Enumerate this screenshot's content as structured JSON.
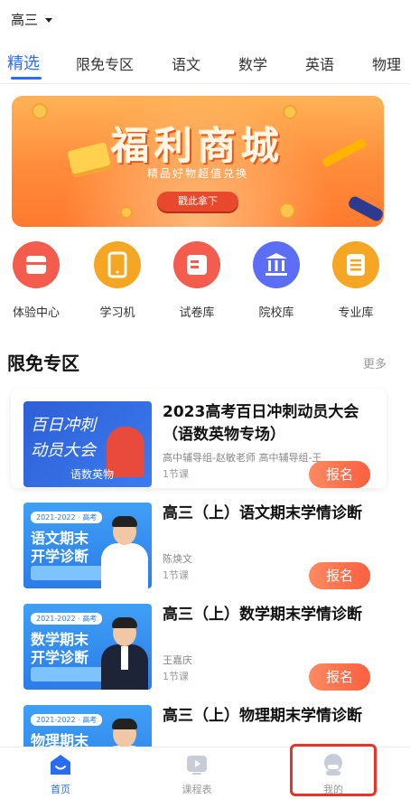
{
  "header": {
    "grade": "高三"
  },
  "tabs": [
    {
      "label": "精选",
      "active": true
    },
    {
      "label": "限免专区",
      "active": false
    },
    {
      "label": "语文",
      "active": false
    },
    {
      "label": "数学",
      "active": false
    },
    {
      "label": "英语",
      "active": false
    },
    {
      "label": "物理",
      "active": false
    }
  ],
  "banner": {
    "title": "福利商城",
    "subtitle": "精品好物超值兑换",
    "button": "戳此拿下"
  },
  "shortcuts": [
    {
      "label": "体验中心",
      "icon": "experience-center-icon",
      "color": "#f45c4e"
    },
    {
      "label": "学习机",
      "icon": "tablet-icon",
      "color": "#f5a623"
    },
    {
      "label": "试卷库",
      "icon": "exam-paper-icon",
      "color": "#f45c4e"
    },
    {
      "label": "院校库",
      "icon": "university-icon",
      "color": "#5b6ef5"
    },
    {
      "label": "专业库",
      "icon": "major-list-icon",
      "color": "#f5a623"
    }
  ],
  "section": {
    "title": "限免专区",
    "more": "更多"
  },
  "courses": [
    {
      "title": "2023高考百日冲刺动员大会（语数英物专场）",
      "teacher": "高中辅导组-赵敏老师 高中辅导组-王",
      "lessons": "1节课",
      "button": "报名",
      "thumb": {
        "line1": "百日冲刺",
        "line2": "动员大会",
        "line3": "语数英物"
      }
    },
    {
      "title": "高三（上）语文期末学情诊断",
      "teacher": "陈焕文",
      "lessons": "1节课",
      "button": "报名",
      "thumb": {
        "tag": "2021-2022 · 高考",
        "line1": "语文期末",
        "line2": "开学诊断"
      }
    },
    {
      "title": "高三（上）数学期末学情诊断",
      "teacher": "王嘉庆",
      "lessons": "1节课",
      "button": "报名",
      "thumb": {
        "tag": "2021-2022 · 高考",
        "line1": "数学期末",
        "line2": "开学诊断"
      }
    },
    {
      "title": "高三（上）物理期末学情诊断",
      "thumb": {
        "tag": "2021-2022 · 高考",
        "line1": "物理期末"
      }
    }
  ],
  "nav": [
    {
      "label": "首页",
      "icon": "home-icon",
      "active": true
    },
    {
      "label": "课程表",
      "icon": "schedule-icon",
      "active": false
    },
    {
      "label": "我的",
      "icon": "profile-icon",
      "active": false
    }
  ],
  "colors": {
    "accent": "#2a6df4",
    "cta": "#ff5f3f",
    "highlight": "#e8332a"
  }
}
